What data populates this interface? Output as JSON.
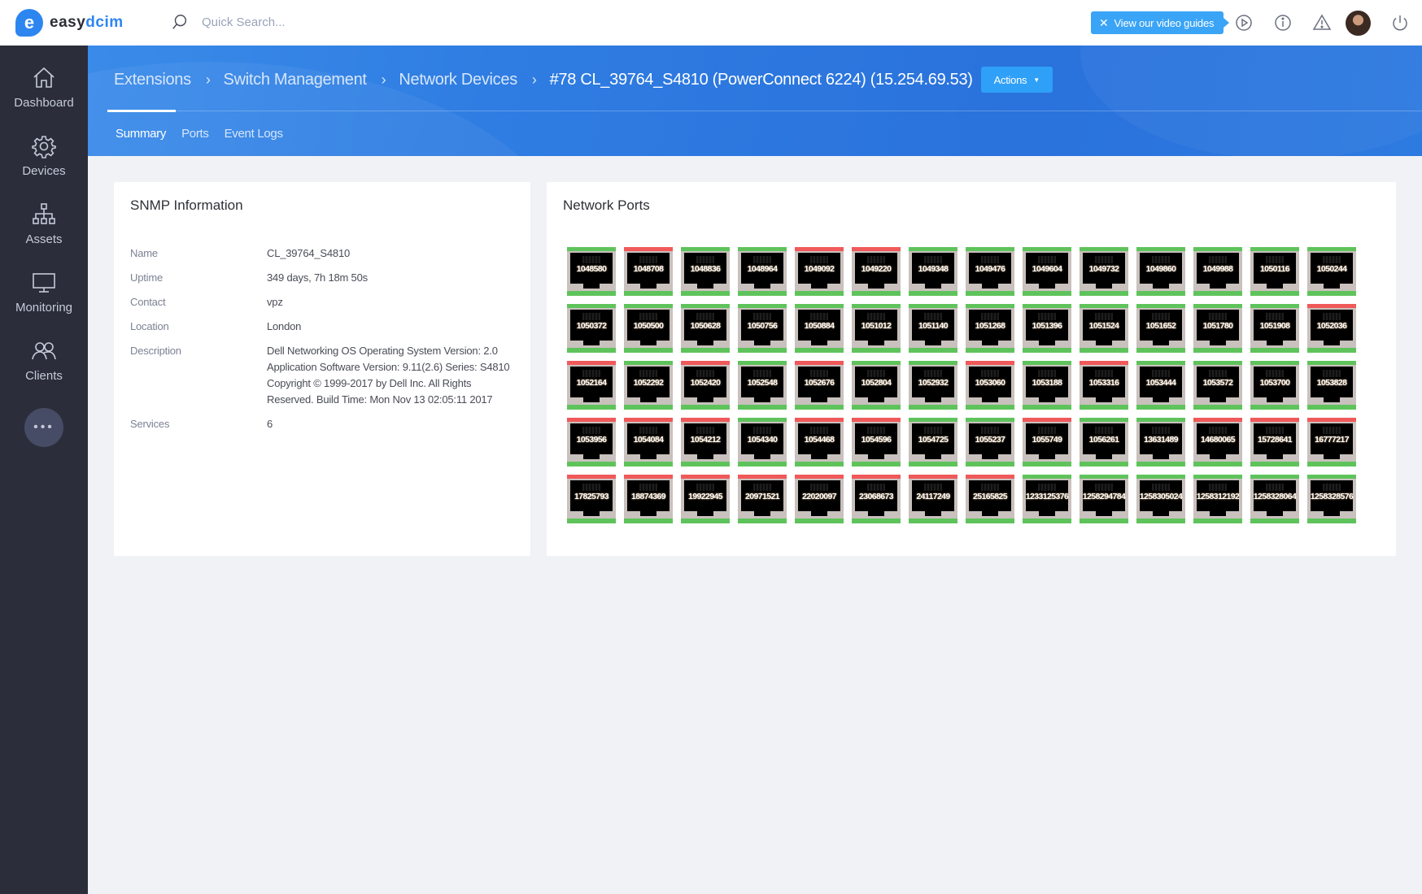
{
  "app": {
    "logo_prefix": "easy",
    "logo_suffix": "dcim",
    "search_placeholder": "Quick Search...",
    "video_guides_label": "View our video guides"
  },
  "colors": {
    "accent": "#2d86f0",
    "port_up": "#5fc35c",
    "port_down": "#f0595a",
    "sidebar_bg": "#2b2e3a"
  },
  "sidebar": {
    "items": [
      {
        "label": "Dashboard",
        "icon": "home-icon"
      },
      {
        "label": "Devices",
        "icon": "gear-icon"
      },
      {
        "label": "Assets",
        "icon": "sitemap-icon"
      },
      {
        "label": "Monitoring",
        "icon": "monitor-icon"
      },
      {
        "label": "Clients",
        "icon": "users-icon"
      }
    ],
    "more_label": "•••"
  },
  "header": {
    "breadcrumbs": [
      "Extensions",
      "Switch Management",
      "Network Devices"
    ],
    "current": "#78 CL_39764_S4810 (PowerConnect 6224) (15.254.69.53)",
    "actions_label": "Actions",
    "tabs": [
      {
        "label": "Summary",
        "active": true
      },
      {
        "label": "Ports",
        "active": false
      },
      {
        "label": "Event Logs",
        "active": false
      }
    ]
  },
  "snmp": {
    "title": "SNMP Information",
    "rows": [
      {
        "key": "Name",
        "value": "CL_39764_S4810"
      },
      {
        "key": "Uptime",
        "value": "349 days, 7h 18m 50s"
      },
      {
        "key": "Contact",
        "value": "vpz"
      },
      {
        "key": "Location",
        "value": "London"
      },
      {
        "key": "Description",
        "value": "Dell Networking OS Operating System Version: 2.0 Application Software Version: 9.11(2.6) Series: S4810 Copyright © 1999-2017 by Dell Inc. All Rights Reserved. Build Time: Mon Nov 13 02:05:11 2017"
      },
      {
        "key": "Services",
        "value": "6"
      }
    ]
  },
  "ports": {
    "title": "Network Ports",
    "items": [
      {
        "id": "1048580",
        "status": "up"
      },
      {
        "id": "1048708",
        "status": "down"
      },
      {
        "id": "1048836",
        "status": "up"
      },
      {
        "id": "1048964",
        "status": "up"
      },
      {
        "id": "1049092",
        "status": "down"
      },
      {
        "id": "1049220",
        "status": "down"
      },
      {
        "id": "1049348",
        "status": "up"
      },
      {
        "id": "1049476",
        "status": "up"
      },
      {
        "id": "1049604",
        "status": "up"
      },
      {
        "id": "1049732",
        "status": "up"
      },
      {
        "id": "1049860",
        "status": "up"
      },
      {
        "id": "1049988",
        "status": "up"
      },
      {
        "id": "1050116",
        "status": "up"
      },
      {
        "id": "1050244",
        "status": "up"
      },
      {
        "id": "1050372",
        "status": "up"
      },
      {
        "id": "1050500",
        "status": "up"
      },
      {
        "id": "1050628",
        "status": "up"
      },
      {
        "id": "1050756",
        "status": "up"
      },
      {
        "id": "1050884",
        "status": "up"
      },
      {
        "id": "1051012",
        "status": "up"
      },
      {
        "id": "1051140",
        "status": "up"
      },
      {
        "id": "1051268",
        "status": "up"
      },
      {
        "id": "1051396",
        "status": "up"
      },
      {
        "id": "1051524",
        "status": "up"
      },
      {
        "id": "1051652",
        "status": "up"
      },
      {
        "id": "1051780",
        "status": "up"
      },
      {
        "id": "1051908",
        "status": "up"
      },
      {
        "id": "1052036",
        "status": "down"
      },
      {
        "id": "1052164",
        "status": "down"
      },
      {
        "id": "1052292",
        "status": "up"
      },
      {
        "id": "1052420",
        "status": "down"
      },
      {
        "id": "1052548",
        "status": "up"
      },
      {
        "id": "1052676",
        "status": "down"
      },
      {
        "id": "1052804",
        "status": "up"
      },
      {
        "id": "1052932",
        "status": "up"
      },
      {
        "id": "1053060",
        "status": "down"
      },
      {
        "id": "1053188",
        "status": "up"
      },
      {
        "id": "1053316",
        "status": "down"
      },
      {
        "id": "1053444",
        "status": "up"
      },
      {
        "id": "1053572",
        "status": "up"
      },
      {
        "id": "1053700",
        "status": "up"
      },
      {
        "id": "1053828",
        "status": "up"
      },
      {
        "id": "1053956",
        "status": "down"
      },
      {
        "id": "1054084",
        "status": "down"
      },
      {
        "id": "1054212",
        "status": "down"
      },
      {
        "id": "1054340",
        "status": "up"
      },
      {
        "id": "1054468",
        "status": "down"
      },
      {
        "id": "1054596",
        "status": "down"
      },
      {
        "id": "1054725",
        "status": "up"
      },
      {
        "id": "1055237",
        "status": "up"
      },
      {
        "id": "1055749",
        "status": "down"
      },
      {
        "id": "1056261",
        "status": "up"
      },
      {
        "id": "13631489",
        "status": "up"
      },
      {
        "id": "14680065",
        "status": "down"
      },
      {
        "id": "15728641",
        "status": "down"
      },
      {
        "id": "16777217",
        "status": "down"
      },
      {
        "id": "17825793",
        "status": "down"
      },
      {
        "id": "18874369",
        "status": "down"
      },
      {
        "id": "19922945",
        "status": "down"
      },
      {
        "id": "20971521",
        "status": "down"
      },
      {
        "id": "22020097",
        "status": "down"
      },
      {
        "id": "23068673",
        "status": "down"
      },
      {
        "id": "24117249",
        "status": "down"
      },
      {
        "id": "25165825",
        "status": "down"
      },
      {
        "id": "1233125376",
        "status": "up"
      },
      {
        "id": "1258294784",
        "status": "up"
      },
      {
        "id": "1258305024",
        "status": "up"
      },
      {
        "id": "1258312192",
        "status": "up"
      },
      {
        "id": "1258328064",
        "status": "up"
      },
      {
        "id": "1258328576",
        "status": "up"
      }
    ]
  }
}
